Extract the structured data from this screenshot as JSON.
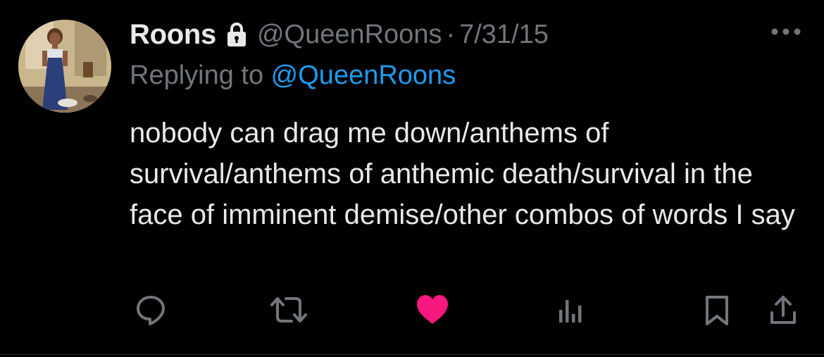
{
  "tweet": {
    "display_name": "Roons",
    "locked": true,
    "handle": "@QueenRoons",
    "separator": "·",
    "date": "7/31/15",
    "reply_prefix": "Replying to ",
    "reply_handle": "@QueenRoons",
    "text": "nobody can drag me down/anthems of survival/anthems of anthemic death/survival in the face of imminent demise/other combos of words I say",
    "liked": true
  },
  "actions": [
    {
      "icon": "reply-icon"
    },
    {
      "icon": "retweet-icon"
    },
    {
      "icon": "heart-icon",
      "active_color": "#f91880"
    },
    {
      "icon": "views-icon"
    },
    {
      "icon": "bookmark-icon"
    },
    {
      "icon": "share-icon"
    }
  ],
  "colors": {
    "background": "#000000",
    "primary_text": "#e7e9ea",
    "secondary_text": "#71767b",
    "link": "#1d9bf0",
    "like": "#f91880"
  }
}
